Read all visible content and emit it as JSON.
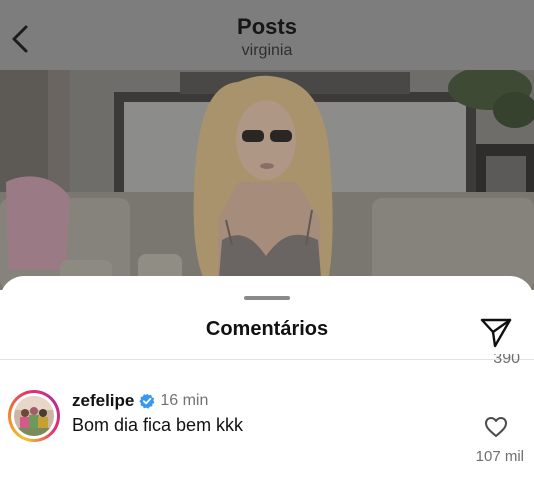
{
  "header": {
    "title": "Posts",
    "username": "virginia",
    "back_icon": "chevron-left-icon"
  },
  "sheet": {
    "title": "Comentários",
    "share_icon": "send-icon",
    "previous_like_count": "390"
  },
  "comments": [
    {
      "username": "zefelipe",
      "verified": true,
      "time": "16 min",
      "text": "Bom dia fica bem kkk",
      "like_count": "107 mil",
      "like_icon": "heart-outline-icon"
    }
  ],
  "colors": {
    "header_bg": "#7d7d7d",
    "verified_blue": "#3897f0",
    "muted_text": "#737373",
    "story_ring": [
      "#f6c12c",
      "#e63268",
      "#b52d9b"
    ]
  }
}
